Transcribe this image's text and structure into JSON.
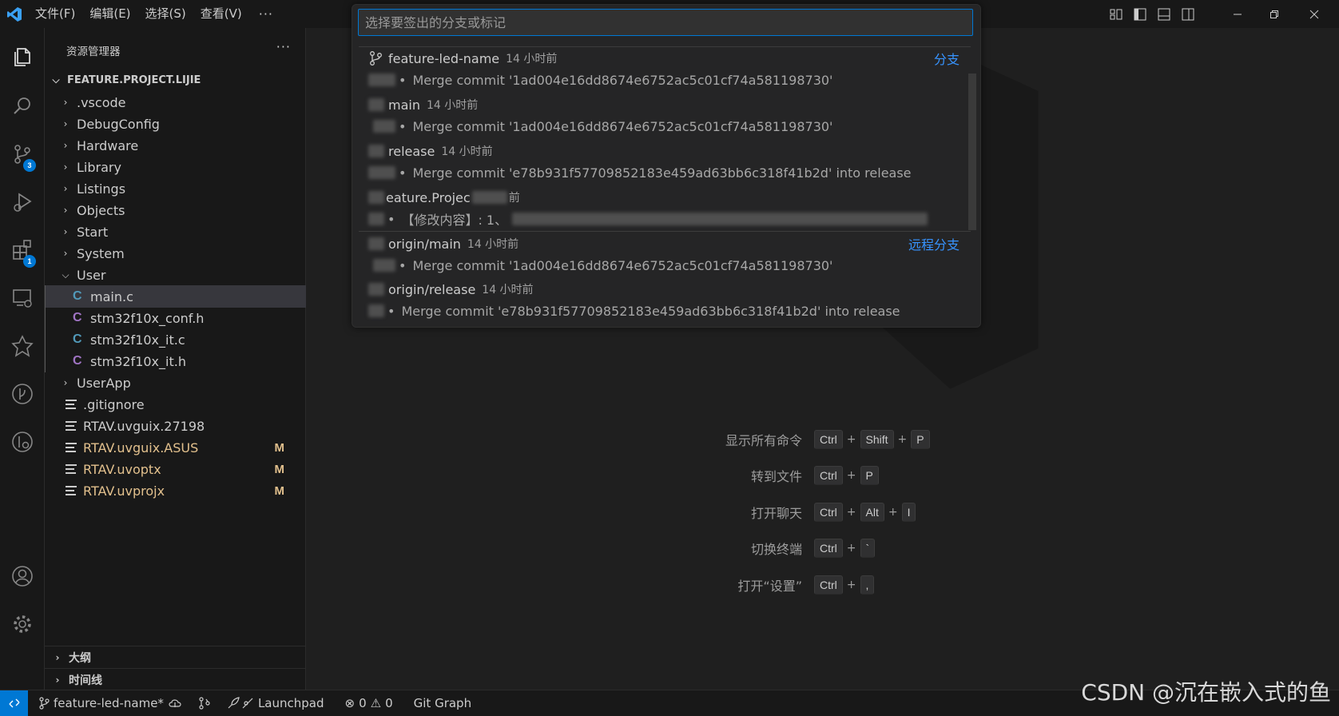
{
  "titlebar": {
    "menus": [
      "文件(F)",
      "编辑(E)",
      "选择(S)",
      "查看(V)"
    ],
    "more": "···"
  },
  "activitybar": {
    "badges": {
      "scm": "3",
      "extensions": "1"
    }
  },
  "sidebar": {
    "title": "资源管理器",
    "more": "···",
    "root": "FEATURE.PROJECT.LIJIE",
    "folders": [
      ".vscode",
      "DebugConfig",
      "Hardware",
      "Library",
      "Listings",
      "Objects",
      "Start",
      "System",
      "User"
    ],
    "user_files": [
      {
        "name": "main.c",
        "type": "c"
      },
      {
        "name": "stm32f10x_conf.h",
        "type": "h"
      },
      {
        "name": "stm32f10x_it.c",
        "type": "c"
      },
      {
        "name": "stm32f10x_it.h",
        "type": "h"
      }
    ],
    "folder_userapp": "UserApp",
    "files": [
      {
        "name": ".gitignore",
        "status": ""
      },
      {
        "name": "RTAV.uvguix.27198",
        "status": ""
      },
      {
        "name": "RTAV.uvguix.ASUS",
        "status": "M"
      },
      {
        "name": "RTAV.uvoptx",
        "status": "M"
      },
      {
        "name": "RTAV.uvprojx",
        "status": "M"
      }
    ],
    "outline": "大纲",
    "timeline": "时间线"
  },
  "quickpick": {
    "placeholder": "选择要签出的分支或标记",
    "items": [
      {
        "name": "feature-led-name",
        "time": "14 小时前",
        "detail": "Merge commit '1ad004e16dd8674e6752ac5c01cf74a581198730'",
        "category": "分支"
      },
      {
        "name": "main",
        "time": "14 小时前",
        "detail": "Merge commit '1ad004e16dd8674e6752ac5c01cf74a581198730'",
        "category": ""
      },
      {
        "name": "release",
        "time": "14 小时前",
        "detail": "Merge commit 'e78b931f57709852183e459ad63bb6c318f41b2d' into release",
        "category": ""
      },
      {
        "name": "eature.Projec",
        "time": "前",
        "detail": "【修改内容】: 1、",
        "category": ""
      },
      {
        "name": "origin/main",
        "time": "14 小时前",
        "detail": "Merge commit '1ad004e16dd8674e6752ac5c01cf74a581198730'",
        "category": "远程分支"
      },
      {
        "name": "origin/release",
        "time": "14 小时前",
        "detail": "Merge commit 'e78b931f57709852183e459ad63bb6c318f41b2d' into release",
        "category": ""
      }
    ]
  },
  "shortcuts": [
    {
      "label": "显示所有命令",
      "keys": [
        "Ctrl",
        "Shift",
        "P"
      ]
    },
    {
      "label": "转到文件",
      "keys": [
        "Ctrl",
        "P"
      ]
    },
    {
      "label": "打开聊天",
      "keys": [
        "Ctrl",
        "Alt",
        "I"
      ]
    },
    {
      "label": "切换终端",
      "keys": [
        "Ctrl",
        "`"
      ]
    },
    {
      "label": "打开“设置”",
      "keys": [
        "Ctrl",
        ","
      ]
    }
  ],
  "statusbar": {
    "branch": "feature-led-name*",
    "launchpad": "Launchpad",
    "errors": "0",
    "warnings": "0",
    "git_graph": "Git Graph"
  },
  "watermark_text": "CSDN @沉在嵌入式的鱼"
}
